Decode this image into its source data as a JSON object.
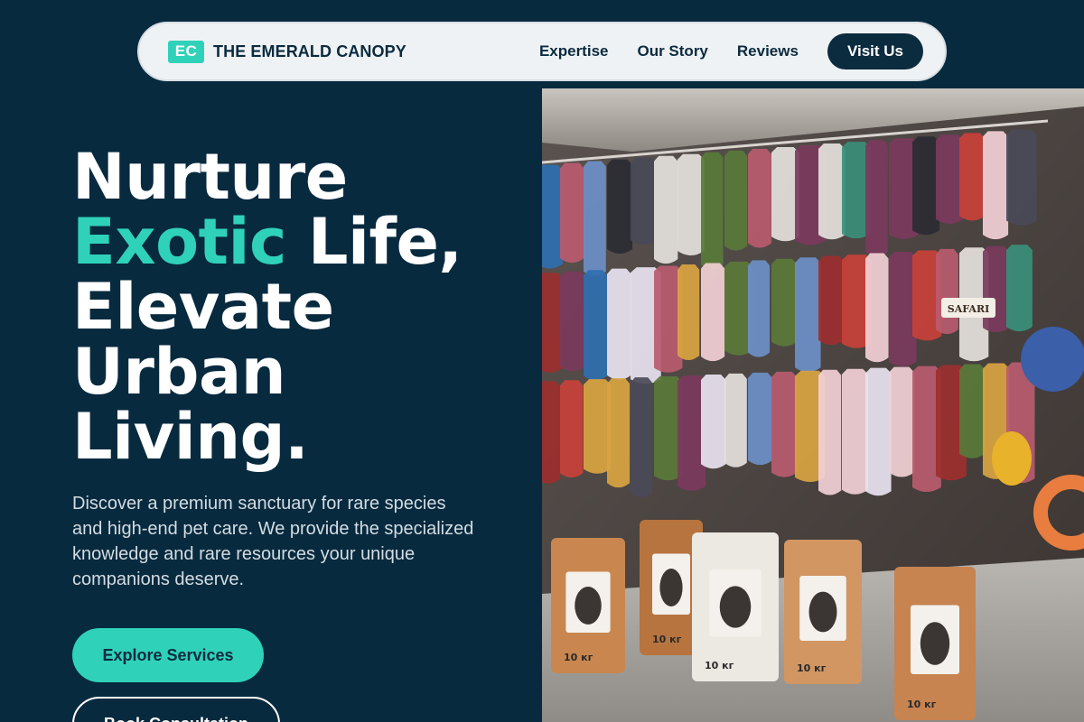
{
  "nav": {
    "logo_mark": "EC",
    "brand_name": "THE EMERALD CANOPY",
    "links": [
      "Expertise",
      "Our Story",
      "Reviews"
    ],
    "cta_label": "Visit Us"
  },
  "hero": {
    "title_line1": "Nurture",
    "title_accent": "Exotic",
    "title_line2_rest": " Life,",
    "title_line3": "Elevate",
    "title_line4": "Urban",
    "title_line5": "Living.",
    "description": "Discover a premium sanctuary for rare species and high-end pet care. We provide the specialized knowledge and rare resources your unique companions deserve.",
    "primary_button": "Explore Services",
    "secondary_button": "Book Consultation"
  },
  "photo": {
    "bag_label": "10 кг",
    "tag_label": "SAFARI"
  },
  "colors": {
    "background": "#082a3f",
    "accent": "#2fd2b9",
    "nav_bg": "#eff2f4"
  }
}
